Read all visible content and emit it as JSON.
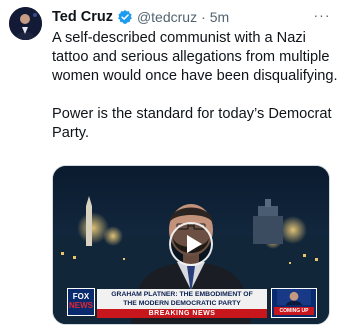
{
  "author": {
    "name": "Ted Cruz",
    "handle": "@tedcruz",
    "separator": "·",
    "time": "5m",
    "verified_icon": "verified-badge-icon"
  },
  "more_icon": "more-options-icon",
  "more_label": "···",
  "tweet": {
    "paragraph_1": "A self-described communist with a Nazi tattoo and serious allegations from multiple women would once have been disqualifying.",
    "paragraph_2": "Power is the standard for today’s Democrat Party."
  },
  "video": {
    "play_icon": "play-icon",
    "network_logo_line1": "FOX",
    "network_logo_line2": "NEWS",
    "headline_line1": "GRAHAM PLATNER: THE EMBODIMENT OF",
    "headline_line2": "THE MODERN DEMOCRATIC PARTY",
    "breaking": "BREAKING NEWS",
    "promo_label": "COMING UP"
  },
  "colors": {
    "text": "#0f1419",
    "secondary": "#536471",
    "verified": "#1d9bf0",
    "fox_blue": "#0a2a6e",
    "breaking_red": "#c8161d"
  }
}
